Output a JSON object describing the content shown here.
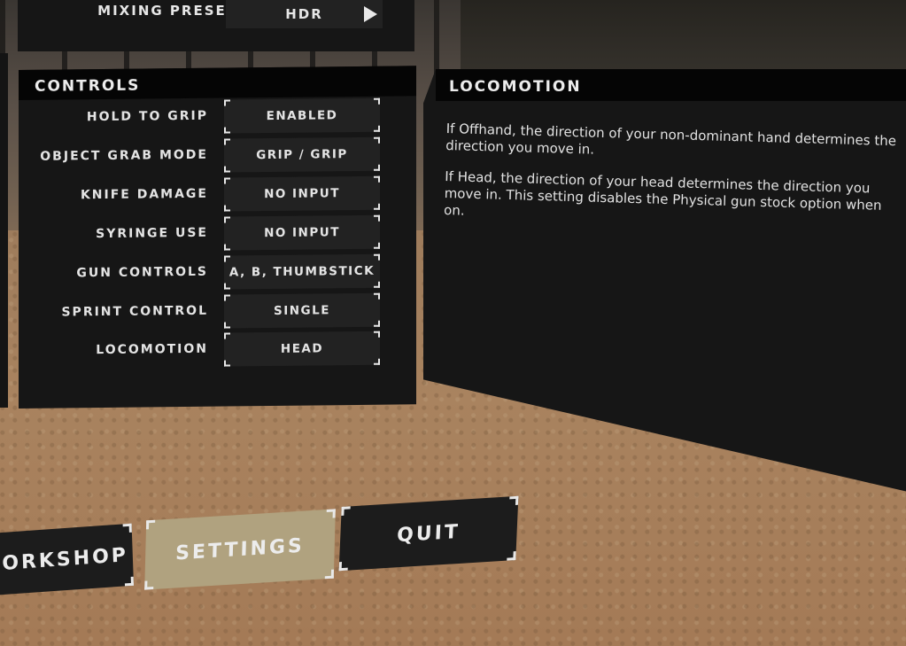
{
  "mixing_preset": {
    "label": "MIXING PRESET",
    "value": "HDR",
    "arrow_icon": "play-triangle-icon"
  },
  "controls": {
    "title": "CONTROLS",
    "rows": [
      {
        "label": "HOLD TO GRIP",
        "value": "ENABLED"
      },
      {
        "label": "OBJECT GRAB MODE",
        "value": "GRIP / GRIP"
      },
      {
        "label": "KNIFE DAMAGE",
        "value": "NO INPUT"
      },
      {
        "label": "SYRINGE USE",
        "value": "NO INPUT"
      },
      {
        "label": "GUN CONTROLS",
        "value": "A, B, THUMBSTICK"
      },
      {
        "label": "SPRINT CONTROL",
        "value": "SINGLE"
      },
      {
        "label": "LOCOMOTION",
        "value": "HEAD"
      }
    ]
  },
  "locomotion_info": {
    "title": "LOCOMOTION",
    "paragraphs": [
      "If Offhand, the direction of your non-dominant hand determines the direction you move in.",
      "If Head, the direction of your head determines the direction you move in. This setting disables the Physical gun stock option when on."
    ]
  },
  "menu": {
    "workshop_label": "WORKSHOP",
    "settings_label": "SETTINGS",
    "quit_label": "QUIT",
    "active": "SETTINGS",
    "active_color": "#b0a27f"
  }
}
